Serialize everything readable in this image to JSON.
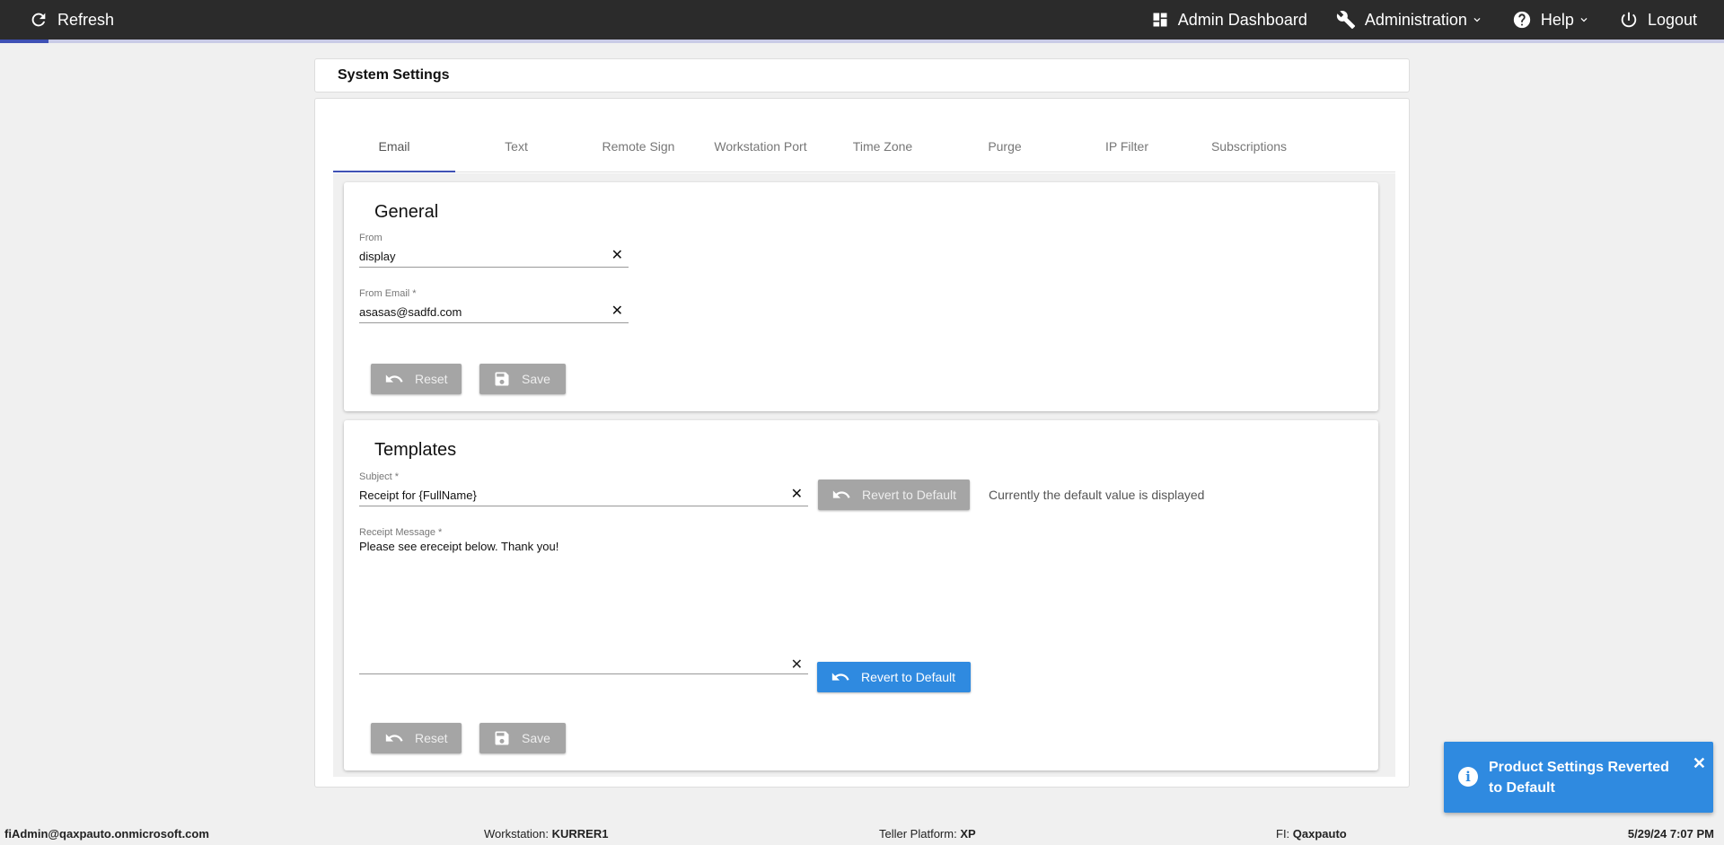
{
  "topbar": {
    "refresh_label": "Refresh",
    "admin_dashboard_label": "Admin Dashboard",
    "administration_label": "Administration",
    "help_label": "Help",
    "logout_label": "Logout",
    "accent_color": "#3f51b5"
  },
  "page": {
    "title": "System Settings"
  },
  "tabs": [
    {
      "label": "Email"
    },
    {
      "label": "Text"
    },
    {
      "label": "Remote Sign"
    },
    {
      "label": "Workstation Port"
    },
    {
      "label": "Time Zone"
    },
    {
      "label": "Purge"
    },
    {
      "label": "IP Filter"
    },
    {
      "label": "Subscriptions"
    }
  ],
  "general": {
    "heading": "General",
    "from_label": "From",
    "from_value": "display",
    "from_email_label": "From Email *",
    "from_email_value": "asasas@sadfd.com",
    "reset_label": "Reset",
    "save_label": "Save"
  },
  "templates": {
    "heading": "Templates",
    "subject_label": "Subject *",
    "subject_value": "Receipt for {FullName}",
    "revert_label": "Revert to Default",
    "default_hint": "Currently the default value is displayed",
    "receipt_label": "Receipt Message *",
    "receipt_value": "Please see ereceipt below. Thank you!",
    "revert_label_2": "Revert to Default",
    "reset_label": "Reset",
    "save_label": "Save"
  },
  "toast": {
    "message": "Product Settings Reverted to Default",
    "color": "#2f8ae0"
  },
  "statusbar": {
    "user": "fiAdmin@qaxpauto.onmicrosoft.com",
    "workstation_label": "Workstation: ",
    "workstation_value": "KURRER1",
    "platform_label": "Teller Platform: ",
    "platform_value": "XP",
    "fi_label": "FI: ",
    "fi_value": "Qaxpauto",
    "datetime": "5/29/24 7:07 PM"
  }
}
